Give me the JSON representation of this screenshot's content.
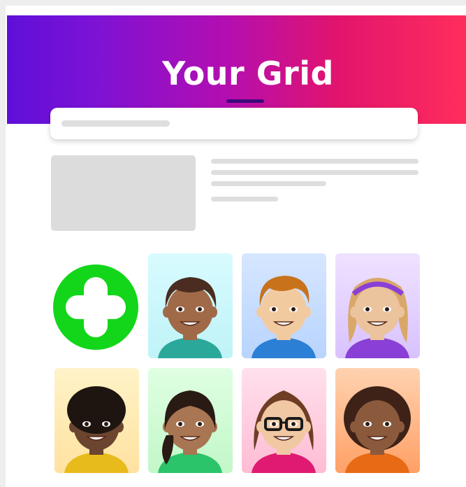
{
  "header": {
    "title": "Your Grid",
    "gradient": [
      "#5f0fd8",
      "#b40eb0",
      "#ff2d5c"
    ]
  },
  "add_button": {
    "icon": "plus-icon",
    "color": "#13d61a"
  },
  "avatars": [
    {
      "icon": "boy-medium-dark-avatar",
      "bg": [
        "#d8fbff",
        "#bff3f7"
      ],
      "skin": "#a06a48",
      "hair": "#4a2c20",
      "shirt": "#2aa89a"
    },
    {
      "icon": "boy-light-avatar",
      "bg": [
        "#d6e6ff",
        "#b8d4ff"
      ],
      "skin": "#f2caa0",
      "hair": "#c8721c",
      "shirt": "#2b7fd4"
    },
    {
      "icon": "girl-light-avatar",
      "bg": [
        "#efe2ff",
        "#d8c2ff"
      ],
      "skin": "#ebc39c",
      "hair": "#d9a868",
      "shirt": "#8a3fd6"
    },
    {
      "icon": "boy-dark-avatar",
      "bg": [
        "#fff3c8",
        "#ffe2a0"
      ],
      "skin": "#6b4530",
      "hair": "#1e1410",
      "shirt": "#e8bb1c"
    },
    {
      "icon": "girl-medium-avatar",
      "bg": [
        "#dfffe2",
        "#c2f7c8"
      ],
      "skin": "#a87652",
      "hair": "#2a1a14",
      "shirt": "#2cc46a"
    },
    {
      "icon": "girl-glasses-avatar",
      "bg": [
        "#ffe0ec",
        "#ffbcd4"
      ],
      "skin": "#f0c8a4",
      "hair": "#6e3d24",
      "shirt": "#e01a72"
    },
    {
      "icon": "girl-curly-avatar",
      "bg": [
        "#ffd2b0",
        "#ffa066"
      ],
      "skin": "#8b5a3c",
      "hair": "#3e2217",
      "shirt": "#e86a14"
    }
  ]
}
